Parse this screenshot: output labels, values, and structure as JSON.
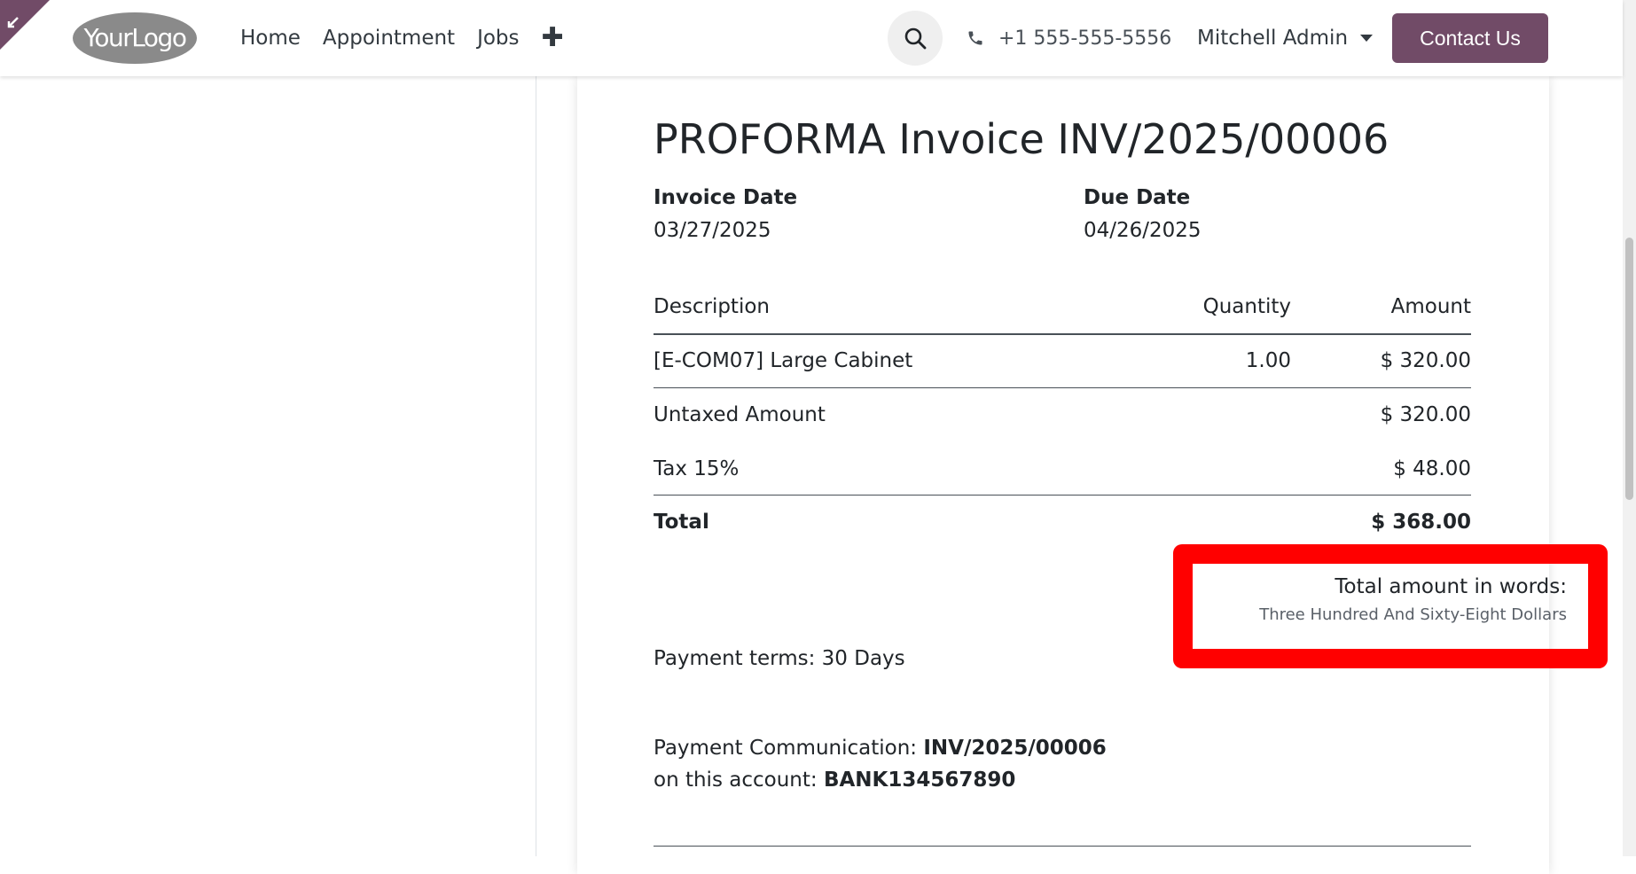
{
  "header": {
    "logo_text": "YourLogo",
    "nav": [
      {
        "label": "Home"
      },
      {
        "label": "Appointment"
      },
      {
        "label": "Jobs"
      }
    ],
    "phone": "+1 555-555-5556",
    "user": "Mitchell Admin",
    "contact_label": "Contact Us"
  },
  "invoice": {
    "title": "PROFORMA Invoice INV/2025/00006",
    "invoice_date_label": "Invoice Date",
    "invoice_date": "03/27/2025",
    "due_date_label": "Due Date",
    "due_date": "04/26/2025",
    "columns": {
      "description": "Description",
      "quantity": "Quantity",
      "amount": "Amount"
    },
    "lines": [
      {
        "description": "[E-COM07] Large Cabinet",
        "quantity": "1.00",
        "amount": "$ 320.00"
      }
    ],
    "untaxed_label": "Untaxed Amount",
    "untaxed_value": "$ 320.00",
    "tax_label": "Tax 15%",
    "tax_value": "$ 48.00",
    "total_label": "Total",
    "total_value": "$ 368.00",
    "words_label": "Total amount in words:",
    "words_value": "Three Hundred And Sixty-Eight Dollars",
    "payment_terms": "Payment terms: 30 Days",
    "payment_comm_label": "Payment Communication: ",
    "payment_comm_value": "INV/2025/00006",
    "account_label": "on this account: ",
    "account_value": "BANK134567890"
  },
  "colors": {
    "brand": "#714b67",
    "highlight": "#ff0000"
  }
}
